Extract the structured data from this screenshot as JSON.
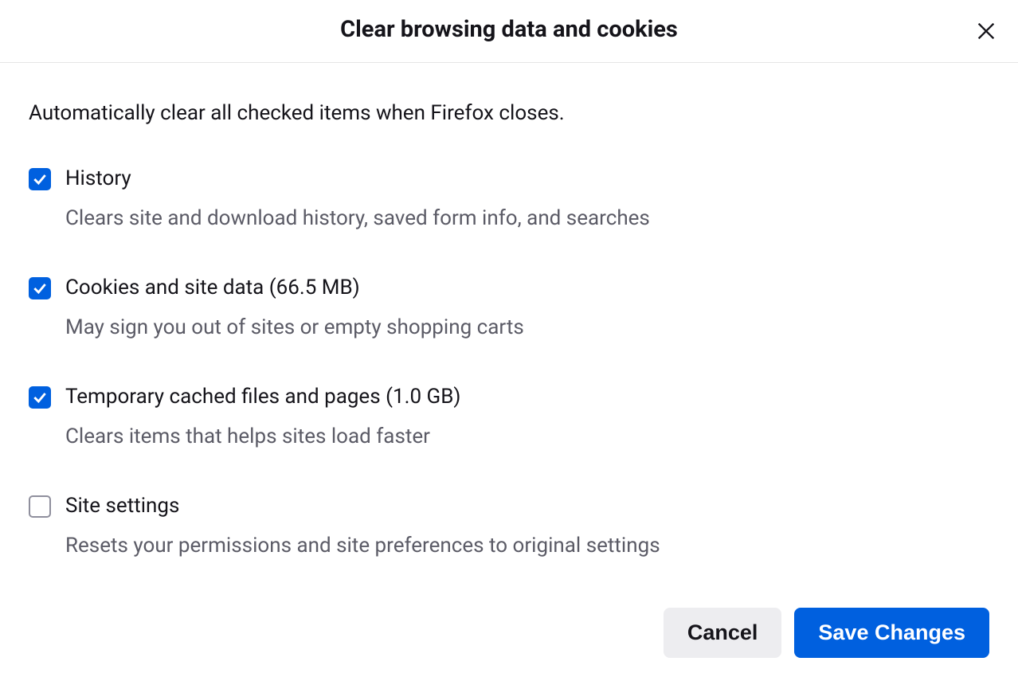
{
  "dialog": {
    "title": "Clear browsing data and cookies",
    "intro": "Automatically clear all checked items when Firefox closes.",
    "options": [
      {
        "label": "History",
        "description": "Clears site and download history, saved form info, and searches",
        "checked": true
      },
      {
        "label": "Cookies and site data (66.5 MB)",
        "description": "May sign you out of sites or empty shopping carts",
        "checked": true
      },
      {
        "label": "Temporary cached files and pages (1.0 GB)",
        "description": "Clears items that helps sites load faster",
        "checked": true
      },
      {
        "label": "Site settings",
        "description": "Resets your permissions and site preferences to original settings",
        "checked": false
      }
    ],
    "buttons": {
      "cancel": "Cancel",
      "save": "Save Changes"
    }
  }
}
